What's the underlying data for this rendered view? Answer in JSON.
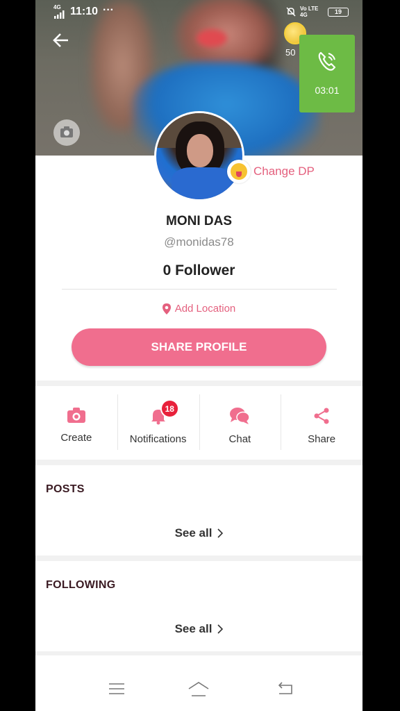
{
  "status_bar": {
    "network": "4G",
    "time": "11:10",
    "more": "···",
    "right_text": "Vo LTE 4G",
    "battery": "19"
  },
  "cover": {
    "coins": "50",
    "call_timer": "03:01"
  },
  "profile": {
    "change_dp_label": "Change DP",
    "name": "MONI DAS",
    "handle": "@monidas78",
    "followers": "0 Follower",
    "location_label": "Add Location",
    "share_button": "SHARE PROFILE"
  },
  "actions": [
    {
      "label": "Create",
      "icon": "camera-icon"
    },
    {
      "label": "Notifications",
      "icon": "bell-icon",
      "badge": "18"
    },
    {
      "label": "Chat",
      "icon": "chat-bubbles-icon"
    },
    {
      "label": "Share",
      "icon": "share-icon"
    }
  ],
  "sections": {
    "posts": {
      "title": "POSTS",
      "see_all": "See all"
    },
    "following": {
      "title": "FOLLOWING",
      "see_all": "See all"
    }
  },
  "colors": {
    "accent": "#f06e8e",
    "accent_text": "#e4607e",
    "badge": "#e8213b",
    "call_green": "#6dbb45"
  }
}
